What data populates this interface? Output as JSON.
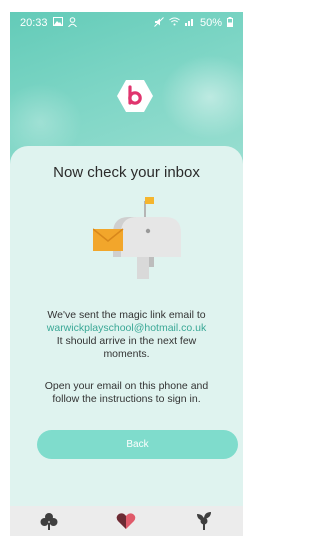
{
  "status_bar": {
    "time": "20:33",
    "left_icons": [
      "image-icon",
      "person-icon"
    ],
    "right_icons": [
      "mute-icon",
      "wifi-icon",
      "signal-icon"
    ],
    "battery": "50%"
  },
  "logo": {
    "icon": "b-logo-icon",
    "color": "#e0356e"
  },
  "card": {
    "title": "Now check your inbox",
    "message_line1": "We've sent the magic link email to",
    "email": "warwickplayschool@hotmail.co.uk",
    "message_line2": "It should arrive in the next few",
    "message_line3": "moments.",
    "instruction_line1": "Open your email on this phone and",
    "instruction_line2": "follow the instructions to sign in.",
    "back_label": "Back"
  },
  "tab_bar": {
    "items": [
      {
        "icon": "tree-icon"
      },
      {
        "icon": "heart-icon"
      },
      {
        "icon": "sprout-icon"
      }
    ]
  },
  "colors": {
    "accent": "#7fdccc",
    "email_link": "#3aa896",
    "card_bg": "#dff3ef",
    "hero_bg": "#63cbb8"
  }
}
